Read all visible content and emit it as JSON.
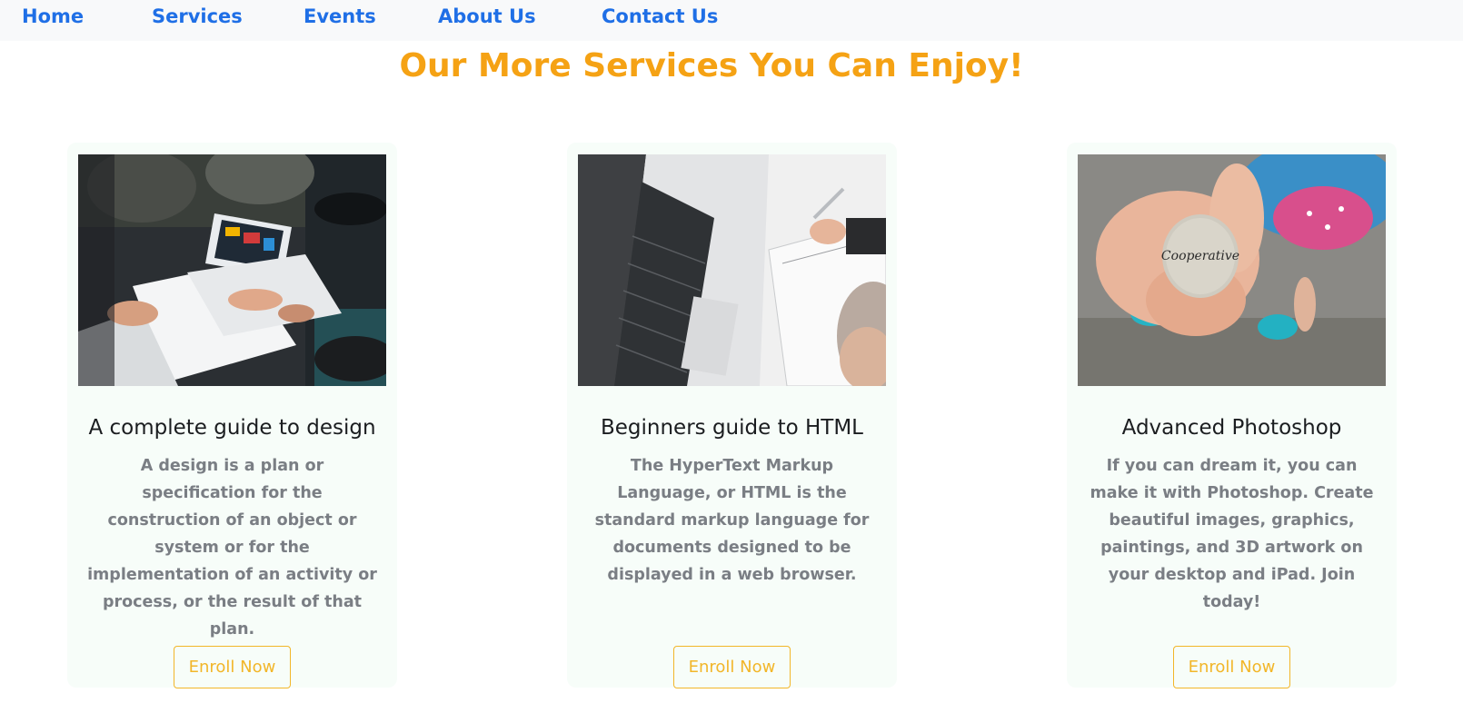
{
  "nav": {
    "items": [
      {
        "label": "Home"
      },
      {
        "label": "Services"
      },
      {
        "label": "Events"
      },
      {
        "label": "About Us"
      },
      {
        "label": "Contact Us"
      }
    ]
  },
  "main": {
    "heading": "Our More Services You Can Enjoy!",
    "cards": [
      {
        "title": "A complete guide to design",
        "text": "A design is a plan or specification for the construction of an object or system or for the implementation of an activity or process, or the result of that plan.",
        "button": "Enroll Now"
      },
      {
        "title": "Beginners guide to HTML",
        "text": "The HyperText Markup Language, or HTML is the standard markup language for documents designed to be displayed in a web browser.",
        "button": "Enroll Now"
      },
      {
        "title": "Advanced Photoshop",
        "text": "If you can dream it, you can make it with Photoshop. Create beautiful images, graphics, paintings, and 3D artwork on your desktop and iPad. Join today!",
        "button": "Enroll Now",
        "image_text": "Cooperative"
      }
    ]
  },
  "colors": {
    "nav_link": "#1f6fe6",
    "heading": "#f5a214",
    "button": "#f2b629",
    "card_bg": "#f7fdf9"
  }
}
